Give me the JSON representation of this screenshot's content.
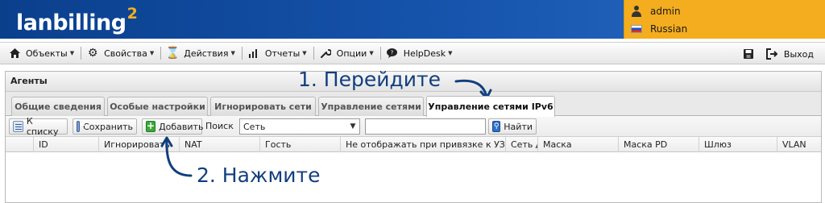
{
  "header": {
    "logo_text": "lanbilling",
    "logo_sup": "2",
    "user_name": "admin",
    "language": "Russian",
    "colors": {
      "header_blue": "#1654ad",
      "user_panel": "#f4ad1e",
      "logo_accent": "#f3b21b"
    }
  },
  "menu": {
    "items": [
      {
        "label": "Объекты",
        "icon": "house-icon"
      },
      {
        "label": "Свойства",
        "icon": "gear-icon"
      },
      {
        "label": "Действия",
        "icon": "hourglass-icon"
      },
      {
        "label": "Отчеты",
        "icon": "bar-chart-icon"
      },
      {
        "label": "Опции",
        "icon": "wrench-icon"
      },
      {
        "label": "HelpDesk",
        "icon": "chat-bubble-icon"
      }
    ],
    "logout_label": "Выход",
    "right_icon": "save-disk-icon",
    "logout_icon": "logout-icon"
  },
  "panel": {
    "title": "Агенты",
    "tabs": [
      "Общие сведения",
      "Особые настройки",
      "Игнорировать сети",
      "Управление сетями",
      "Управление сетями IPv6"
    ],
    "active_tab": "Управление сетями IPv6"
  },
  "toolbar": {
    "back_label": "К списку",
    "save_label": "Сохранить",
    "add_label": "Добавить",
    "search_label": "Поиск",
    "search_field_value": "Сеть",
    "search_input_value": "",
    "find_label": "Найти"
  },
  "grid": {
    "columns": [
      "",
      "ID",
      "Игнорировать",
      "NAT",
      "Гость",
      "Не отображать при привязке к УЗ",
      "Сеть",
      "Маска",
      "Маска PD",
      "Шлюз",
      "VLAN"
    ],
    "sorted_column": "Сеть"
  },
  "annotations": {
    "step1": "1. Перейдите",
    "step2": "2. Нажмите"
  }
}
